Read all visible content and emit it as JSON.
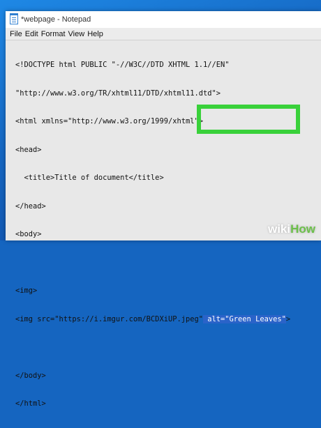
{
  "window": {
    "title": "*webpage - Notepad"
  },
  "menubar": {
    "items": [
      "File",
      "Edit",
      "Format",
      "View",
      "Help"
    ]
  },
  "editor": {
    "lines": [
      "<!DOCTYPE html PUBLIC \"-//W3C//DTD XHTML 1.1//EN\"",
      "\"http://www.w3.org/TR/xhtml11/DTD/xhtml11.dtd\">",
      "<html xmlns=\"http://www.w3.org/1999/xhtml\">",
      "<head>",
      "  <title>Title of document</title>",
      "</head>",
      "<body>",
      "",
      "<img>",
      "",
      "",
      "</body>",
      "</html>"
    ],
    "img_line": {
      "before": "<img src=\"https://i.imgur.com/BCDXiUP.jpeg\"",
      "selected": " alt=\"Green Leaves\"",
      "after": ">"
    }
  },
  "colors": {
    "highlight_border": "#39d13a",
    "selection": "#2a63c9",
    "desktop": "#1565c0"
  },
  "watermark": {
    "part1": "wiki",
    "part2": "How"
  }
}
